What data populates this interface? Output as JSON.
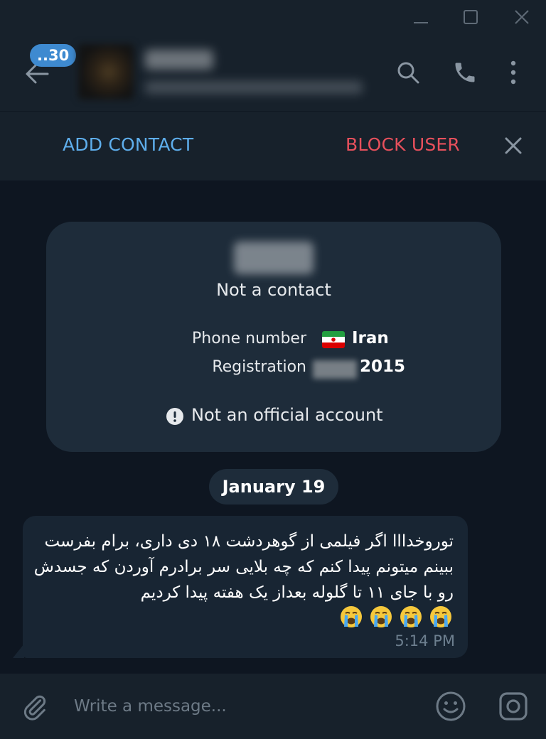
{
  "header": {
    "unread_count": "..30"
  },
  "actions": {
    "add_contact": "ADD CONTACT",
    "block_user": "BLOCK USER"
  },
  "info_card": {
    "status": "Not a contact",
    "phone_label": "Phone number",
    "phone_country": "Iran",
    "registration_label": "Registration",
    "registration_year": "2015",
    "official_notice": "Not an official account"
  },
  "chat": {
    "date_separator": "January 19",
    "messages": [
      {
        "text": "توروخدااا اگر فیلمی از گوهردشت ۱۸ دی داری، برام بفرست ببینم میتونم پیدا کنم که چه بلایی سر برادرم آوردن که جسدش رو با جای ۱۱ تا گلوله بعداز یک هفته پیدا کردیم",
        "emoji": [
          "loudly-crying-face",
          "loudly-crying-face",
          "loudly-crying-face",
          "loudly-crying-face"
        ],
        "time": "5:14 PM"
      }
    ]
  },
  "composer": {
    "placeholder": "Write a message..."
  },
  "colors": {
    "background": "#0e1621",
    "panel": "#17212b",
    "card": "#1e2c3a",
    "bubble": "#182533",
    "accent_blue": "#5eaeec",
    "danger_red": "#e7505c",
    "badge_blue": "#3e8ad0"
  }
}
